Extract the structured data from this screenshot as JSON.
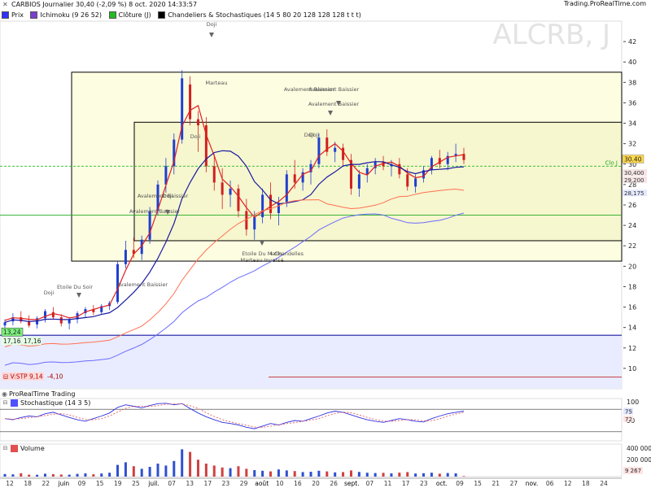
{
  "header": {
    "title": "CARBIOS Journalier 30,40 (-2,09 %) 8 oct. 2020 14:33:57",
    "site": "Trading.ProRealTime.com",
    "legend": [
      {
        "label": "Prix",
        "color": "#3030ff"
      },
      {
        "label": "Ichimoku (9 26 52)",
        "color": "#7a3fd0"
      },
      {
        "label": "Clôture (J)",
        "color": "#22bb22"
      },
      {
        "label": "Chandeliers & Stochastiques (14 5 80 20 128 128 128 t t t)",
        "color": "#000000"
      }
    ]
  },
  "watermark": "ALCRB, J",
  "price_panel": {
    "ylim": [
      8,
      44
    ],
    "ticks": [
      10,
      12,
      14,
      16,
      18,
      20,
      22,
      24,
      26,
      28,
      30,
      32,
      34,
      36,
      38,
      40,
      42
    ],
    "last_price": "30.40",
    "price_tags": [
      "30,400",
      "29,200",
      "28,175"
    ],
    "close_label": "Clo J",
    "left_tags": {
      "top": "13,24",
      "left": "17,16",
      "right": "17,16"
    },
    "stop_label": "V:STP",
    "stop_value": "9,14",
    "stop_change": "-4,10",
    "annotations": [
      "Doji",
      "Marteau",
      "Doji",
      "Doji",
      "Avalement Baissier",
      "Avalement Baissier",
      "Doji",
      "Avalement Baissier",
      "Doji",
      "Etoile Du Soir",
      "Avalement Baissier",
      "Etoile Du Matin",
      "4 Chandelles",
      "Marteau Inversé",
      "Avalement Baissier",
      "Avalement Baissier",
      "Doji"
    ]
  },
  "stoch_panel": {
    "title": "Stochastique (14 3 5)",
    "ticks": [
      "100",
      "50"
    ],
    "tags": [
      "75",
      "72"
    ]
  },
  "volume_panel": {
    "title": "Volume",
    "ticks": [
      "400 000",
      "200 000"
    ],
    "tag": "9 267"
  },
  "footer": {
    "logo": "ProRealTime Trading"
  },
  "x_axis": {
    "labels": [
      "12",
      "18",
      "22",
      "juin",
      "09",
      "15",
      "19",
      "25",
      "juil.",
      "07",
      "13",
      "17",
      "23",
      "29",
      "août",
      "10",
      "16",
      "20",
      "26",
      "sept.",
      "07",
      "11",
      "17",
      "23",
      "oct.",
      "09",
      "15",
      "21",
      "27",
      "nov.",
      "06",
      "12",
      "18",
      "24"
    ]
  },
  "chart_data": {
    "type": "candlestick",
    "title": "CARBIOS Journalier",
    "series": [
      {
        "name": "Prix",
        "type": "candlestick",
        "values": [
          [
            14.2,
            14.8,
            13.9,
            14.5
          ],
          [
            14.6,
            15.4,
            14.2,
            15.0
          ],
          [
            15.0,
            15.6,
            14.4,
            14.6
          ],
          [
            14.6,
            15.2,
            14.0,
            14.2
          ],
          [
            14.3,
            15.1,
            13.9,
            14.9
          ],
          [
            14.9,
            15.8,
            14.5,
            15.6
          ],
          [
            15.5,
            16.0,
            14.8,
            15.0
          ],
          [
            15.0,
            15.3,
            14.1,
            14.4
          ],
          [
            14.4,
            15.0,
            13.8,
            14.8
          ],
          [
            14.8,
            15.6,
            14.4,
            15.4
          ],
          [
            15.4,
            16.0,
            15.0,
            15.8
          ],
          [
            15.8,
            16.2,
            15.2,
            15.5
          ],
          [
            15.5,
            16.3,
            15.3,
            16.1
          ],
          [
            16.1,
            16.6,
            15.7,
            16.4
          ],
          [
            16.5,
            20.5,
            16.3,
            20.2
          ],
          [
            20.2,
            22.5,
            19.8,
            21.6
          ],
          [
            21.6,
            22.8,
            20.8,
            21.2
          ],
          [
            21.2,
            23.0,
            20.6,
            22.6
          ],
          [
            22.6,
            25.8,
            22.2,
            25.4
          ],
          [
            25.4,
            28.4,
            25.0,
            28.0
          ],
          [
            28.0,
            30.6,
            27.2,
            29.8
          ],
          [
            29.8,
            33.0,
            29.0,
            32.4
          ],
          [
            32.4,
            39.2,
            32.0,
            38.4
          ],
          [
            37.8,
            38.6,
            33.8,
            34.4
          ],
          [
            34.4,
            35.2,
            31.2,
            33.8
          ],
          [
            33.8,
            34.6,
            29.2,
            29.8
          ],
          [
            29.8,
            31.0,
            27.4,
            28.2
          ],
          [
            28.2,
            29.6,
            25.6,
            27.0
          ],
          [
            27.0,
            28.4,
            25.8,
            27.6
          ],
          [
            27.6,
            28.0,
            24.8,
            25.4
          ],
          [
            25.4,
            26.6,
            23.0,
            23.6
          ],
          [
            23.6,
            25.4,
            22.6,
            24.8
          ],
          [
            24.8,
            27.6,
            24.2,
            27.0
          ],
          [
            27.0,
            28.2,
            24.6,
            25.2
          ],
          [
            25.2,
            26.8,
            24.0,
            26.2
          ],
          [
            26.2,
            29.4,
            25.8,
            29.0
          ],
          [
            29.0,
            30.4,
            27.6,
            28.2
          ],
          [
            28.2,
            29.6,
            27.4,
            29.2
          ],
          [
            29.2,
            30.4,
            28.0,
            30.0
          ],
          [
            30.0,
            33.0,
            29.6,
            32.6
          ],
          [
            32.6,
            33.4,
            30.8,
            31.2
          ],
          [
            31.2,
            32.2,
            30.2,
            31.6
          ],
          [
            31.6,
            32.0,
            29.8,
            30.4
          ],
          [
            30.4,
            31.0,
            27.0,
            27.6
          ],
          [
            27.6,
            29.4,
            26.8,
            29.0
          ],
          [
            29.0,
            30.0,
            28.2,
            29.6
          ],
          [
            29.6,
            30.6,
            29.0,
            30.2
          ],
          [
            30.2,
            30.8,
            29.4,
            29.8
          ],
          [
            29.8,
            30.4,
            28.8,
            30.0
          ],
          [
            30.0,
            30.6,
            28.6,
            29.0
          ],
          [
            29.0,
            29.6,
            27.4,
            27.8
          ],
          [
            27.8,
            29.0,
            27.2,
            28.6
          ],
          [
            28.6,
            29.8,
            28.2,
            29.4
          ],
          [
            29.4,
            30.8,
            29.0,
            30.6
          ],
          [
            30.6,
            31.4,
            29.6,
            30.0
          ],
          [
            30.0,
            31.2,
            29.4,
            30.8
          ],
          [
            30.8,
            32.0,
            30.2,
            31.0
          ],
          [
            31.0,
            31.6,
            30.0,
            30.4
          ]
        ]
      },
      {
        "name": "Stochastique",
        "type": "line",
        "values": [
          55,
          52,
          58,
          62,
          60,
          68,
          72,
          65,
          58,
          52,
          48,
          55,
          62,
          70,
          85,
          92,
          88,
          84,
          90,
          95,
          96,
          92,
          95,
          82,
          70,
          60,
          52,
          45,
          42,
          38,
          32,
          28,
          35,
          42,
          38,
          45,
          50,
          48,
          55,
          62,
          70,
          75,
          72,
          65,
          58,
          52,
          48,
          45,
          50,
          55,
          52,
          48,
          46,
          55,
          62,
          68,
          72,
          75
        ]
      },
      {
        "name": "Volume",
        "type": "bar",
        "values": [
          40000,
          35000,
          52000,
          30000,
          28000,
          45000,
          38000,
          32000,
          30000,
          42000,
          50000,
          36000,
          48000,
          60000,
          180000,
          220000,
          160000,
          120000,
          150000,
          200000,
          170000,
          240000,
          420000,
          380000,
          260000,
          200000,
          170000,
          140000,
          130000,
          160000,
          120000,
          100000,
          90000,
          80000,
          110000,
          95000,
          85000,
          70000,
          75000,
          90000,
          80000,
          65000,
          70000,
          95000,
          72000,
          60000,
          55000,
          58000,
          50000,
          62000,
          70000,
          48000,
          52000,
          60000,
          45000,
          55000,
          50000,
          9267
        ]
      }
    ],
    "ylim": [
      8,
      44
    ],
    "grid": false
  }
}
